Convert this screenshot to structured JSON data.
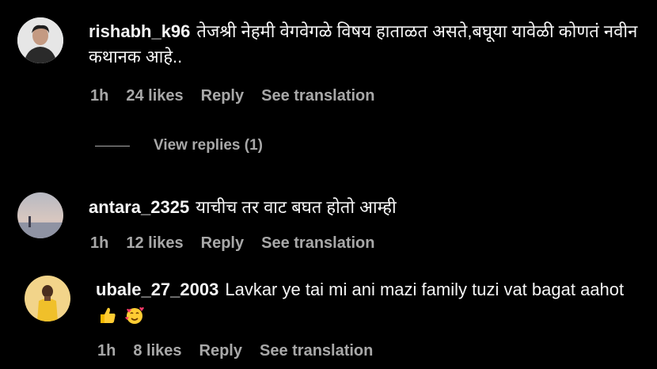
{
  "comments": [
    {
      "username": "rishabh_k96",
      "text": "तेजश्री नेहमी वेगवेगळे विषय हाताळत असते,बघूया यावेळी कोणतं नवीन कथानक आहे..",
      "time": "1h",
      "likes": "24 likes",
      "reply": "Reply",
      "translate": "See translation"
    },
    {
      "username": "antara_2325",
      "text": "याचीच तर वाट बघत होतो आम्ही",
      "time": "1h",
      "likes": "12 likes",
      "reply": "Reply",
      "translate": "See translation"
    },
    {
      "username": "ubale_27_2003",
      "text": "Lavkar ye tai mi ani mazi family tuzi vat bagat aahot",
      "time": "1h",
      "likes": "8 likes",
      "reply": "Reply",
      "translate": "See translation",
      "emojis": [
        "thumbs-up-emoji",
        "smiling-face-with-hearts-emoji"
      ]
    }
  ],
  "view_replies": "View replies (1)",
  "colors": {
    "background": "#000000",
    "text": "#f5f5f5",
    "meta": "#a8a8a8"
  }
}
